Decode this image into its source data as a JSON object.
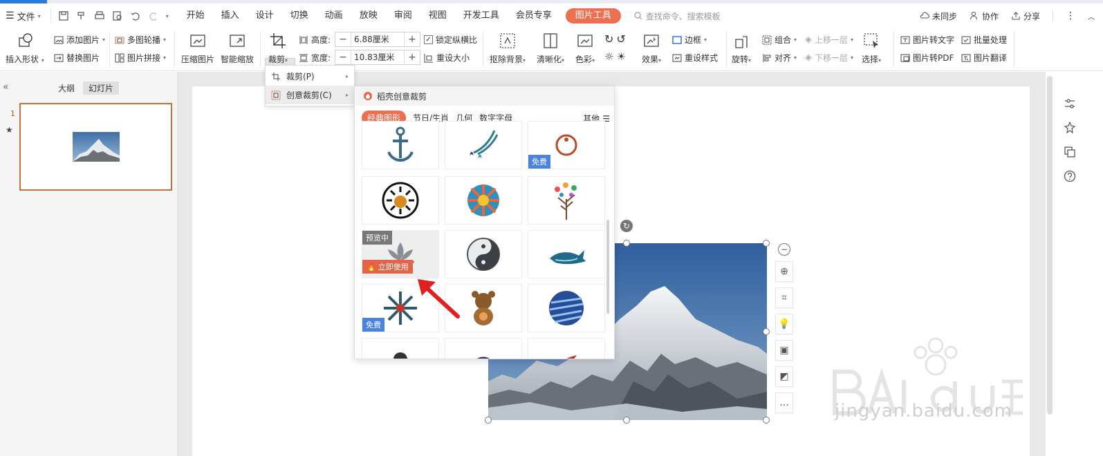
{
  "menubar": {
    "file": "文件",
    "tabs": [
      "开始",
      "插入",
      "设计",
      "切换",
      "动画",
      "放映",
      "审阅",
      "视图",
      "开发工具",
      "会员专享"
    ],
    "active_tab": "图片工具",
    "search_placeholder": "查找命令、搜索模板",
    "sync": "未同步",
    "collab": "协作",
    "share": "分享"
  },
  "ribbon": {
    "insert_shape": "插入形状",
    "add_picture": "添加图片",
    "replace_picture": "替换图片",
    "multi_carousel": "多图轮播",
    "picture_splice": "图片拼接",
    "compress": "压缩图片",
    "smart_zoom": "智能缩放",
    "crop": "裁剪",
    "height_label": "高度:",
    "height_value": "6.88厘米",
    "width_label": "宽度:",
    "width_value": "10.83厘米",
    "lock_ratio": "锁定纵横比",
    "reset_size": "重设大小",
    "remove_bg": "抠除背景",
    "sharpen": "清晰化",
    "color": "色彩",
    "effects": "效果",
    "border": "边框",
    "reset_style": "重设样式",
    "rotate": "旋转",
    "group": "组合",
    "align": "对齐",
    "bring_forward": "上移一层",
    "send_backward": "下移一层",
    "select": "选择",
    "pic_to_text": "图片转文字",
    "batch_process": "批量处理",
    "pic_to_pdf": "图片转PDF",
    "pic_translate": "图片翻译"
  },
  "left_panel": {
    "tab_outline": "大纲",
    "tab_slides": "幻灯片",
    "slide_number": "1"
  },
  "crop_menu": {
    "items": [
      {
        "label": "裁剪(P)"
      },
      {
        "label": "创意裁剪(C)"
      }
    ]
  },
  "creative_crop": {
    "title": "稻壳创意裁剪",
    "categories": [
      "经典图形",
      "节日/生肖",
      "几何",
      "数字字母"
    ],
    "more": "其他",
    "badge_free": "免费",
    "badge_preview": "预览中",
    "badge_use": "立即使用"
  },
  "watermark": {
    "text": "jingyan.baidu.com"
  },
  "colors": {
    "accent": "#ec6f4f",
    "free_badge": "#4a84e0",
    "thumb_border": "#c6703d",
    "arrow": "#e0201f"
  }
}
